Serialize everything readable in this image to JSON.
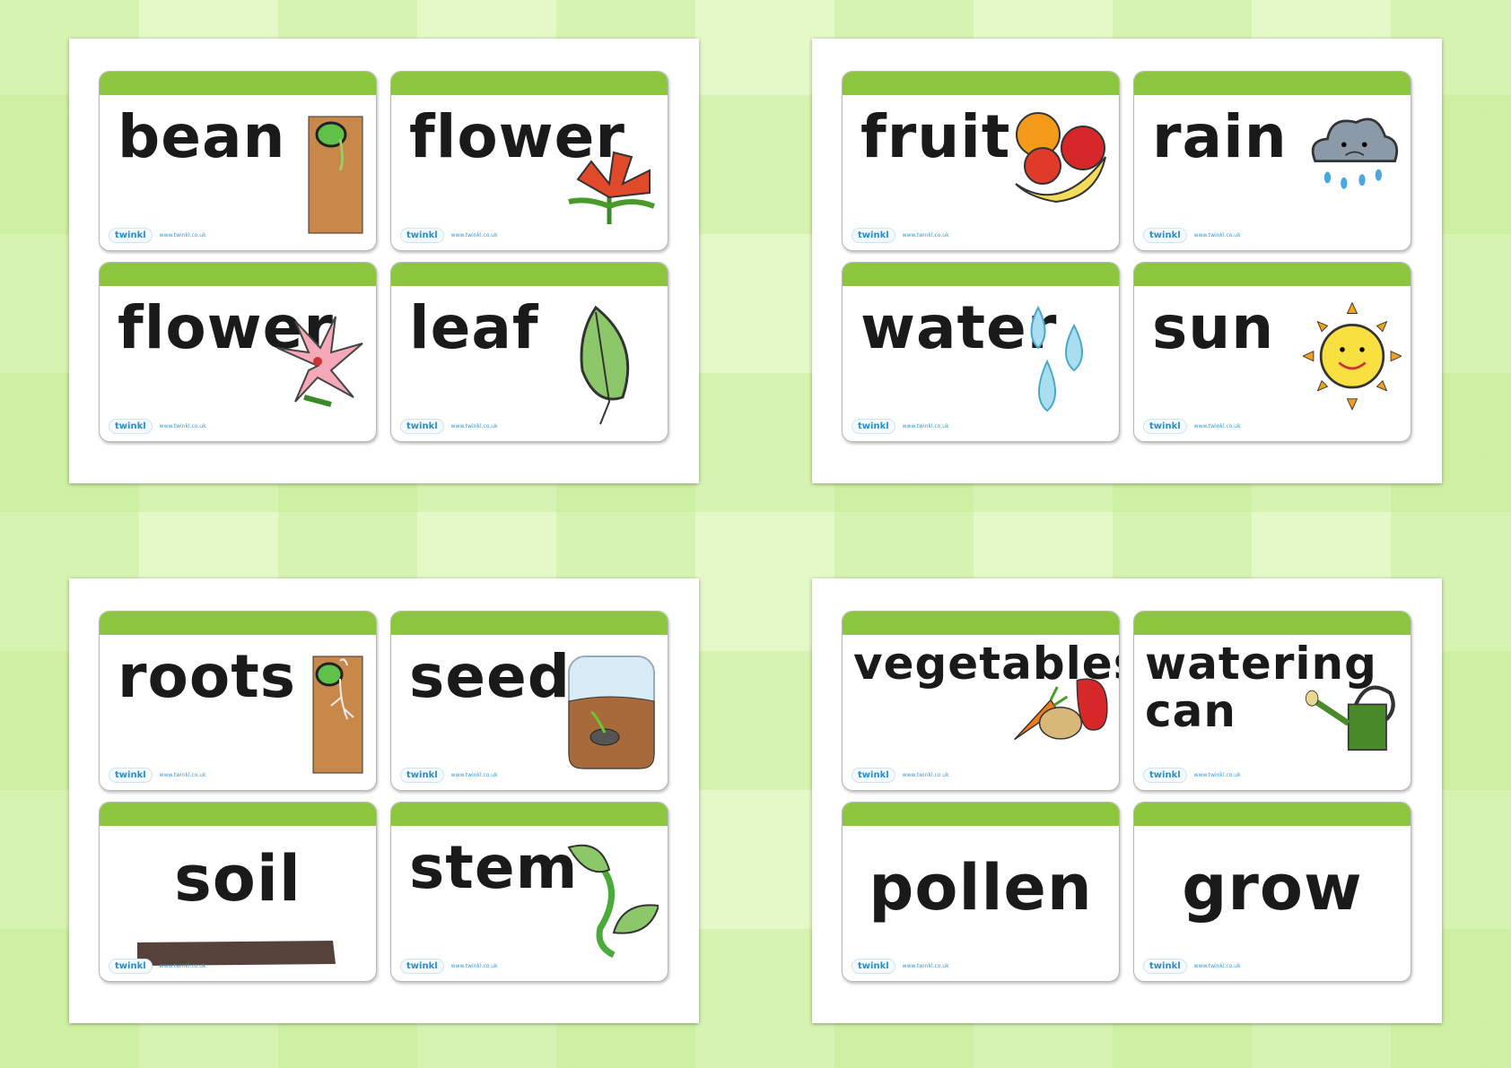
{
  "footer": {
    "logo": "twinkl",
    "url": "www.twinkl.co.uk"
  },
  "colors": {
    "header_bar": "#8cc63f",
    "background": "#e4f8c8",
    "word": "#1a1a1a"
  },
  "sheets": [
    {
      "cards": [
        {
          "word": "bean",
          "icon": "bean-sprout-icon"
        },
        {
          "word": "flower",
          "icon": "red-flower-icon"
        },
        {
          "word": "flower",
          "icon": "pink-lily-icon"
        },
        {
          "word": "leaf",
          "icon": "leaf-icon"
        }
      ]
    },
    {
      "cards": [
        {
          "word": "fruit",
          "icon": "fruit-icon"
        },
        {
          "word": "rain",
          "icon": "rain-cloud-icon"
        },
        {
          "word": "water",
          "icon": "water-drops-icon"
        },
        {
          "word": "sun",
          "icon": "sun-icon"
        }
      ]
    },
    {
      "cards": [
        {
          "word": "roots",
          "icon": "roots-icon"
        },
        {
          "word": "seeds",
          "icon": "seed-jar-icon"
        },
        {
          "word": "soil",
          "icon": "soil-icon"
        },
        {
          "word": "stem",
          "icon": "stem-icon"
        }
      ]
    },
    {
      "cards": [
        {
          "word": "vegetables",
          "icon": "vegetables-icon"
        },
        {
          "word": "watering\ncan",
          "icon": "watering-can-icon"
        },
        {
          "word": "pollen",
          "icon": ""
        },
        {
          "word": "grow",
          "icon": ""
        }
      ]
    }
  ]
}
